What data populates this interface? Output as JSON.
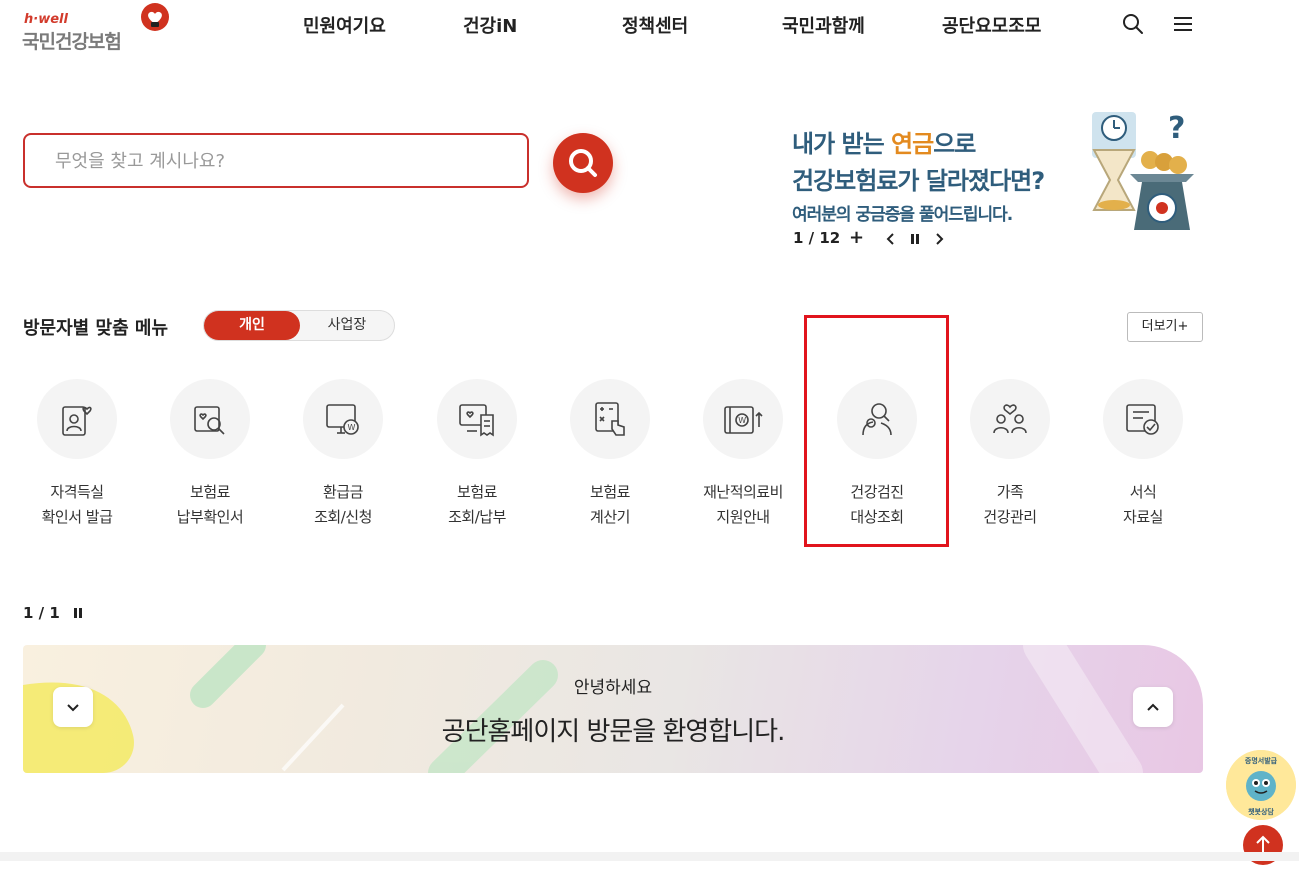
{
  "header": {
    "logo_small": "h·well",
    "logo_main": "국민건강보험",
    "nav": [
      "민원여기요",
      "건강iN",
      "정책센터",
      "국민과함께",
      "공단요모조모"
    ],
    "search_icon": "search-icon",
    "menu_icon": "hamburger-menu-icon"
  },
  "search": {
    "placeholder": "무엇을 찾고 계시나요?",
    "button_icon": "search-icon"
  },
  "banner": {
    "line1_pre": "내가 받는 ",
    "line1_accent": "연금",
    "line1_post": "으로",
    "line2": "건강보험료가 달라졌다면?",
    "line3": "여러분의 궁금증을 풀어드립니다.",
    "counter": "1 / 12",
    "plus": "+"
  },
  "visitor_menu": {
    "title": "방문자별 맞춤 메뉴",
    "toggle_on": "개인",
    "toggle_off": "사업장",
    "more": "더보기+",
    "items": [
      {
        "line1": "자격득실",
        "line2": "확인서 발급",
        "icon": "id-card-heart-icon"
      },
      {
        "line1": "보험료",
        "line2": "납부확인서",
        "icon": "document-search-icon"
      },
      {
        "line1": "환급금",
        "line2": "조회/신청",
        "icon": "monitor-won-icon"
      },
      {
        "line1": "보험료",
        "line2": "조회/납부",
        "icon": "screen-receipt-icon"
      },
      {
        "line1": "보험료",
        "line2": "계산기",
        "icon": "calculator-hand-icon"
      },
      {
        "line1": "재난적의료비",
        "line2": "지원안내",
        "icon": "wallet-won-up-icon"
      },
      {
        "line1": "건강검진",
        "line2": "대상조회",
        "icon": "person-search-icon"
      },
      {
        "line1": "가족",
        "line2": "건강관리",
        "icon": "family-heart-icon"
      },
      {
        "line1": "서식",
        "line2": "자료실",
        "icon": "form-check-icon"
      }
    ],
    "pager": "1 / 1"
  },
  "notice": {
    "greeting": "안녕하세요",
    "message": "공단홈페이지 방문을 환영합니다."
  },
  "chatbot": {
    "top_text": "증명서발급",
    "bottom_text": "챗봇상담"
  },
  "colors": {
    "brand_red": "#d0321f",
    "banner_blue": "#2f5d7c",
    "banner_accent": "#e38a1f",
    "highlight": "#e1141d"
  }
}
